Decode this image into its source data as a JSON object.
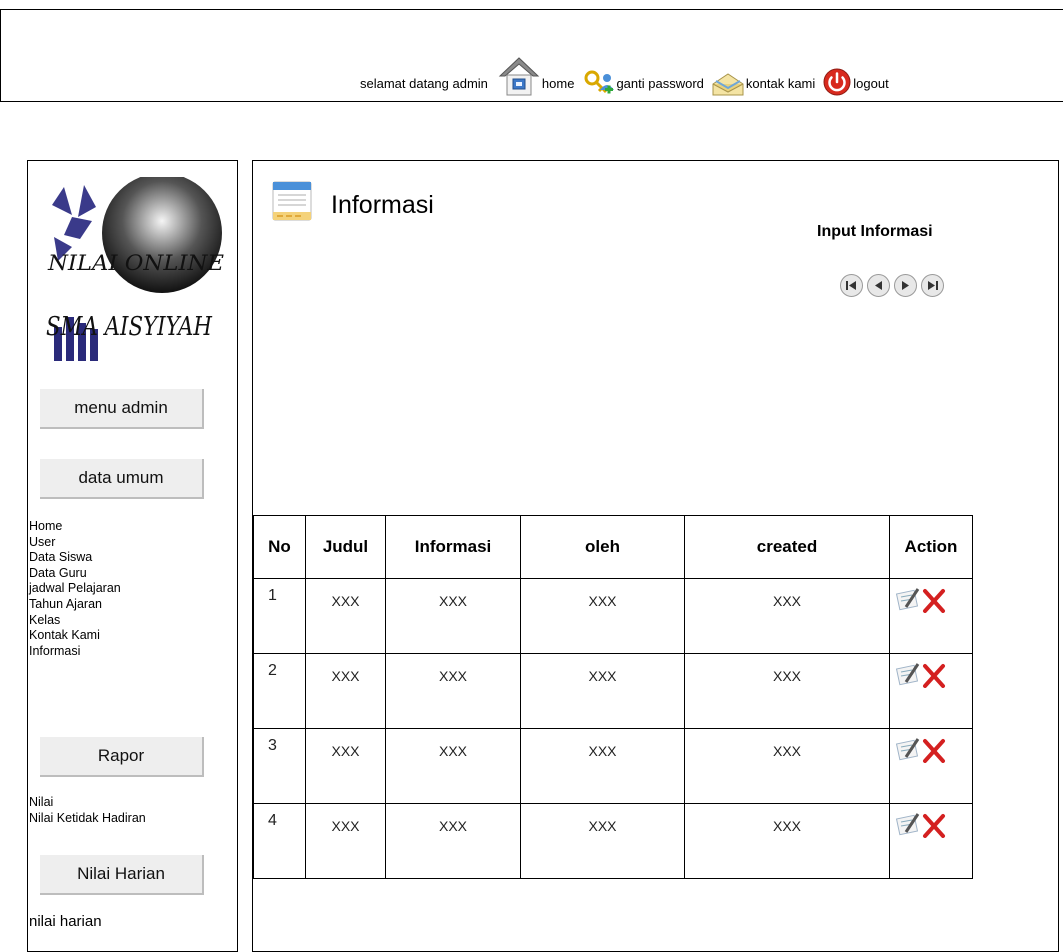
{
  "header": {
    "welcome": "selamat datang admin",
    "nav": [
      {
        "label": "home",
        "icon": "home-icon"
      },
      {
        "label": "ganti password",
        "icon": "key-user-icon"
      },
      {
        "label": "kontak kami",
        "icon": "envelope-icon"
      },
      {
        "label": "logout",
        "icon": "power-icon"
      }
    ]
  },
  "sidebar": {
    "logo_text_1": "NILAI ONLINE",
    "logo_text_2": "SMA AISYIYAH",
    "buttons": {
      "menu_admin": "menu admin",
      "data_umum": "data umum",
      "rapor": "Rapor",
      "nilai_harian": "Nilai Harian"
    },
    "data_umum_items": [
      "Home",
      "User",
      "Data Siswa",
      "Data Guru",
      "jadwal Pelajaran",
      "Tahun Ajaran",
      "Kelas",
      "Kontak Kami",
      "Informasi"
    ],
    "rapor_items": [
      "Nilai",
      "Nilai Ketidak Hadiran"
    ],
    "nilai_harian_items": [
      "nilai harian"
    ]
  },
  "main": {
    "title": "Informasi",
    "input_link": "Input Informasi",
    "pager": [
      "first-icon",
      "prev-icon",
      "next-icon",
      "last-icon"
    ],
    "table": {
      "headers": [
        "No",
        "Judul",
        "Informasi",
        "oleh",
        "created",
        "Action"
      ],
      "rows": [
        [
          "1",
          "XXX",
          "XXX",
          "XXX",
          "XXX"
        ],
        [
          "2",
          "XXX",
          "XXX",
          "XXX",
          "XXX"
        ],
        [
          "3",
          "XXX",
          "XXX",
          "XXX",
          "XXX"
        ],
        [
          "4",
          "XXX",
          "XXX",
          "XXX",
          "XXX"
        ]
      ],
      "action_icons": [
        "edit-icon",
        "delete-icon"
      ]
    }
  },
  "colors": {
    "border": "#000000",
    "button_bg": "#eeeeee",
    "delete_red": "#d42020"
  }
}
